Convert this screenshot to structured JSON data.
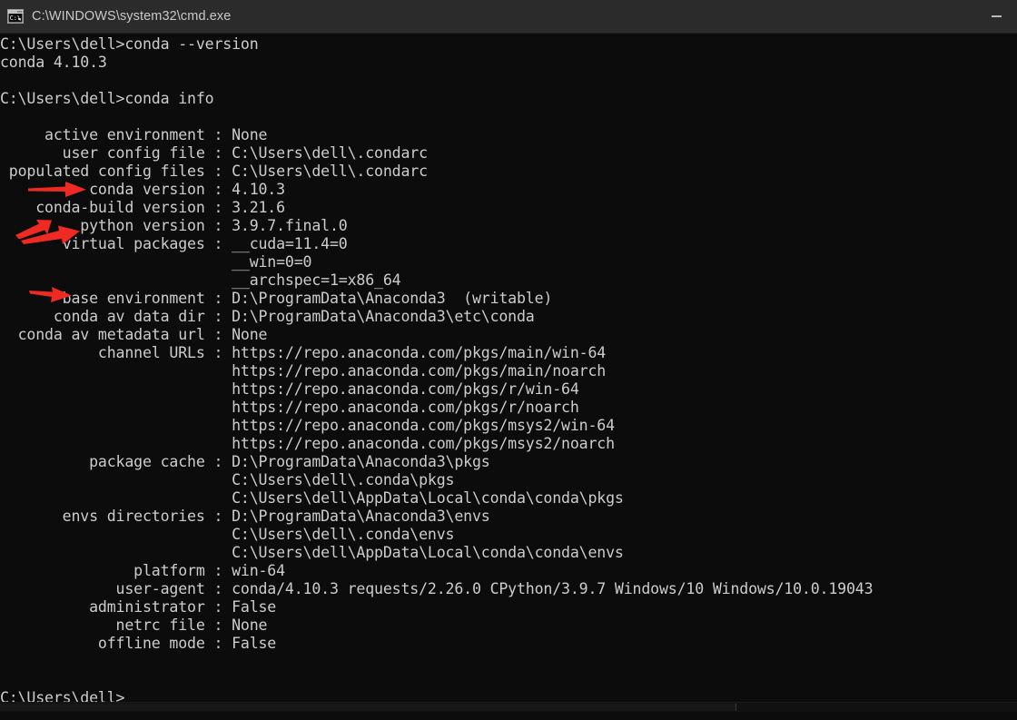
{
  "window": {
    "title": "C:\\WINDOWS\\system32\\cmd.exe",
    "icon": "cmd-console-icon",
    "minimize_label": "—",
    "titlebar_color": "#2b2b2b",
    "background_color": "#0c0c0c",
    "text_color": "#cccccc",
    "annotation_color": "#ee2a22"
  },
  "terminal": {
    "prompt": "C:\\Users\\dell>",
    "commands": [
      {
        "prompt": "C:\\Users\\dell>",
        "command": "conda --version"
      },
      {
        "prompt": "C:\\Users\\dell>",
        "command": "conda info"
      }
    ],
    "version_output": "conda 4.10.3",
    "info": [
      {
        "key": "active environment",
        "values": [
          "None"
        ]
      },
      {
        "key": "user config file",
        "values": [
          "C:\\Users\\dell\\.condarc"
        ]
      },
      {
        "key": "populated config files",
        "values": [
          "C:\\Users\\dell\\.condarc"
        ]
      },
      {
        "key": "conda version",
        "values": [
          "4.10.3"
        ],
        "annotated": true
      },
      {
        "key": "conda-build version",
        "values": [
          "3.21.6"
        ]
      },
      {
        "key": "python version",
        "values": [
          "3.9.7.final.0"
        ],
        "annotated": true
      },
      {
        "key": "virtual packages",
        "values": [
          "__cuda=11.4=0",
          "__win=0=0",
          "__archspec=1=x86_64"
        ]
      },
      {
        "key": "base environment",
        "values": [
          "D:\\ProgramData\\Anaconda3  (writable)"
        ],
        "annotated": true
      },
      {
        "key": "conda av data dir",
        "values": [
          "D:\\ProgramData\\Anaconda3\\etc\\conda"
        ]
      },
      {
        "key": "conda av metadata url",
        "values": [
          "None"
        ]
      },
      {
        "key": "channel URLs",
        "values": [
          "https://repo.anaconda.com/pkgs/main/win-64",
          "https://repo.anaconda.com/pkgs/main/noarch",
          "https://repo.anaconda.com/pkgs/r/win-64",
          "https://repo.anaconda.com/pkgs/r/noarch",
          "https://repo.anaconda.com/pkgs/msys2/win-64",
          "https://repo.anaconda.com/pkgs/msys2/noarch"
        ]
      },
      {
        "key": "package cache",
        "values": [
          "D:\\ProgramData\\Anaconda3\\pkgs",
          "C:\\Users\\dell\\.conda\\pkgs",
          "C:\\Users\\dell\\AppData\\Local\\conda\\conda\\pkgs"
        ]
      },
      {
        "key": "envs directories",
        "values": [
          "D:\\ProgramData\\Anaconda3\\envs",
          "C:\\Users\\dell\\.conda\\envs",
          "C:\\Users\\dell\\AppData\\Local\\conda\\conda\\envs"
        ]
      },
      {
        "key": "platform",
        "values": [
          "win-64"
        ]
      },
      {
        "key": "user-agent",
        "values": [
          "conda/4.10.3 requests/2.26.0 CPython/3.9.7 Windows/10 Windows/10.0.19043"
        ]
      },
      {
        "key": "administrator",
        "values": [
          "False"
        ]
      },
      {
        "key": "netrc file",
        "values": [
          "None"
        ]
      },
      {
        "key": "offline mode",
        "values": [
          "False"
        ]
      }
    ],
    "screen_text": "C:\\Users\\dell>conda --version\nconda 4.10.3\n\nC:\\Users\\dell>conda info\n\n     active environment : None\n       user config file : C:\\Users\\dell\\.condarc\n populated config files : C:\\Users\\dell\\.condarc\n          conda version : 4.10.3\n    conda-build version : 3.21.6\n         python version : 3.9.7.final.0\n       virtual packages : __cuda=11.4=0\n                          __win=0=0\n                          __archspec=1=x86_64\n       base environment : D:\\ProgramData\\Anaconda3  (writable)\n      conda av data dir : D:\\ProgramData\\Anaconda3\\etc\\conda\n  conda av metadata url : None\n           channel URLs : https://repo.anaconda.com/pkgs/main/win-64\n                          https://repo.anaconda.com/pkgs/main/noarch\n                          https://repo.anaconda.com/pkgs/r/win-64\n                          https://repo.anaconda.com/pkgs/r/noarch\n                          https://repo.anaconda.com/pkgs/msys2/win-64\n                          https://repo.anaconda.com/pkgs/msys2/noarch\n          package cache : D:\\ProgramData\\Anaconda3\\pkgs\n                          C:\\Users\\dell\\.conda\\pkgs\n                          C:\\Users\\dell\\AppData\\Local\\conda\\conda\\pkgs\n       envs directories : D:\\ProgramData\\Anaconda3\\envs\n                          C:\\Users\\dell\\.conda\\envs\n                          C:\\Users\\dell\\AppData\\Local\\conda\\conda\\envs\n               platform : win-64\n             user-agent : conda/4.10.3 requests/2.26.0 CPython/3.9.7 Windows/10 Windows/10.0.19043\n          administrator : False\n             netrc file : None\n           offline mode : False\n\n\nC:\\Users\\dell>"
  },
  "annotations": [
    {
      "name": "arrow-conda-version",
      "target": "conda version"
    },
    {
      "name": "arrow-python-version-upper",
      "target": "python version"
    },
    {
      "name": "arrow-python-version-lower",
      "target": "python version"
    },
    {
      "name": "arrow-base-environment",
      "target": "base environment"
    }
  ],
  "scrollbar": {
    "orientation": "horizontal",
    "thumb_fraction": "0.72"
  }
}
